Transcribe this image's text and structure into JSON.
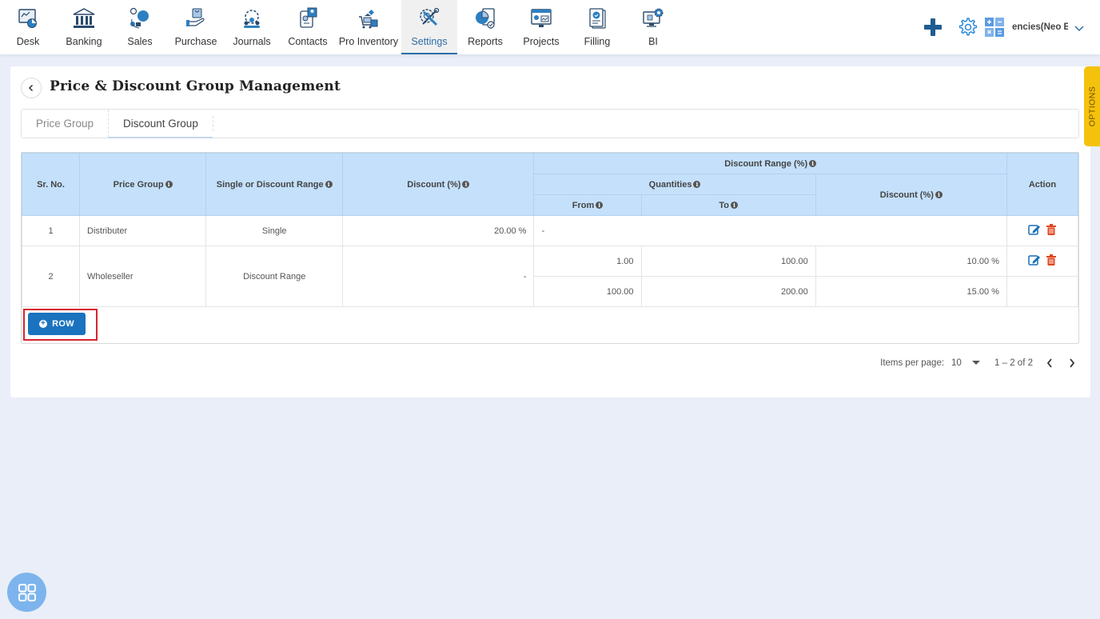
{
  "topnav": {
    "items": [
      {
        "label": "Desk",
        "icon": "desk-icon",
        "active": false
      },
      {
        "label": "Banking",
        "icon": "bank-icon",
        "active": false
      },
      {
        "label": "Sales",
        "icon": "sales-icon",
        "active": false
      },
      {
        "label": "Purchase",
        "icon": "purchase-icon",
        "active": false
      },
      {
        "label": "Journals",
        "icon": "journals-icon",
        "active": false
      },
      {
        "label": "Contacts",
        "icon": "contacts-icon",
        "active": false
      },
      {
        "label": "Pro Inventory",
        "icon": "inventory-icon",
        "active": false
      },
      {
        "label": "Settings",
        "icon": "settings-icon",
        "active": true
      },
      {
        "label": "Reports",
        "icon": "reports-icon",
        "active": false
      },
      {
        "label": "Projects",
        "icon": "projects-icon",
        "active": false
      },
      {
        "label": "Filling",
        "icon": "filling-icon",
        "active": false
      },
      {
        "label": "BI",
        "icon": "bi-icon",
        "active": false
      }
    ],
    "company_name": "encies(Neo E",
    "right_icons": [
      "plus-icon",
      "gear-icon",
      "calculator-icon",
      "chevron-down-icon"
    ]
  },
  "page": {
    "title": "Price & Discount Group Management",
    "back_icon": "chevron-left-icon"
  },
  "tabs": [
    {
      "label": "Price Group",
      "active": false
    },
    {
      "label": "Discount Group",
      "active": true
    }
  ],
  "table": {
    "headers": {
      "sr_no": "Sr. No.",
      "price_group": "Price Group",
      "single_or_range": "Single or Discount Range",
      "discount": "Discount (%)",
      "discount_range": "Discount Range (%)",
      "quantities": "Quantities",
      "from": "From",
      "to": "To",
      "range_discount": "Discount (%)",
      "action": "Action"
    },
    "rows": [
      {
        "sr_no": "1",
        "price_group": "Distributer",
        "type": "Single",
        "discount": "20.00 %",
        "range_placeholder": "-"
      },
      {
        "sr_no": "2",
        "price_group": "Wholeseller",
        "type": "Discount Range",
        "discount": "-",
        "ranges": [
          {
            "from": "1.00",
            "to": "100.00",
            "discount": "10.00 %"
          },
          {
            "from": "100.00",
            "to": "200.00",
            "discount": "15.00 %"
          }
        ]
      }
    ],
    "add_row_label": "ROW"
  },
  "paginator": {
    "items_per_page_label": "Items per page:",
    "items_per_page": "10",
    "range_label": "1 – 2 of 2"
  },
  "options_tab": "OPTIONS",
  "colors": {
    "header_bg": "#c4e0fb",
    "primary": "#1a73be",
    "active_nav": "#2d6ea8",
    "options_tab": "#f5c20b",
    "delete_icon": "#e0461f",
    "highlight_border": "#d8242f"
  }
}
